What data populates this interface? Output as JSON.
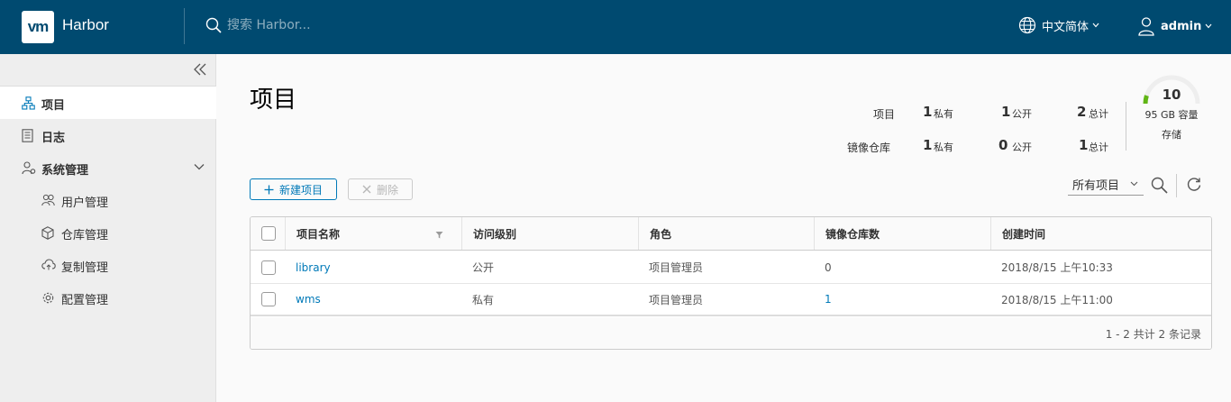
{
  "header": {
    "logo_text": "vm",
    "app_name": "Harbor",
    "search_placeholder": "搜索 Harbor...",
    "language": "中文简体",
    "username": "admin"
  },
  "sidebar": {
    "items": [
      {
        "label": "项目",
        "icon": "projects-icon",
        "active": true
      },
      {
        "label": "日志",
        "icon": "log-icon"
      },
      {
        "label": "系统管理",
        "icon": "admin-icon"
      },
      {
        "label": "用户管理",
        "icon": "users-icon"
      },
      {
        "label": "仓库管理",
        "icon": "registry-icon"
      },
      {
        "label": "复制管理",
        "icon": "replication-icon"
      },
      {
        "label": "配置管理",
        "icon": "settings-icon"
      }
    ]
  },
  "main": {
    "title": "项目",
    "stats": {
      "projects_label": "项目",
      "repos_label": "镜像仓库",
      "private_label": "私有",
      "public_label": "公开",
      "total_label": "总计",
      "projects": {
        "private": "1",
        "public": "1",
        "total": "2"
      },
      "repos": {
        "private": "1",
        "public": "0",
        "total": "1"
      }
    },
    "storage": {
      "value": "10",
      "caption": "95 GB 容量",
      "label": "存储",
      "used_fraction": 0.1
    },
    "toolbar": {
      "new_label": "新建项目",
      "delete_label": "删除",
      "filter_value": "所有项目"
    },
    "table": {
      "columns": [
        "项目名称",
        "访问级别",
        "角色",
        "镜像仓库数",
        "创建时间"
      ],
      "rows": [
        {
          "name": "library",
          "access": "公开",
          "role": "项目管理员",
          "repos": "0",
          "created": "2018/8/15 上午10:33"
        },
        {
          "name": "wms",
          "access": "私有",
          "role": "项目管理员",
          "repos": "1",
          "created": "2018/8/15 上午11:00"
        }
      ],
      "footer": "1 - 2 共计 2 条记录"
    }
  },
  "colors": {
    "header_bg": "#004a70",
    "accent": "#0079b8",
    "gauge_fill": "#60b515"
  }
}
